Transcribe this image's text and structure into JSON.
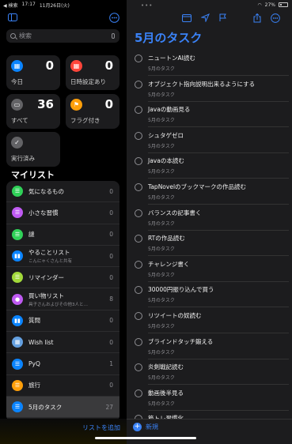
{
  "status": {
    "back": "◀ 検索",
    "time": "17:17",
    "date": "11月26日(火)",
    "battery": "27%"
  },
  "sidebar": {
    "search_placeholder": "検索",
    "smart_lists": [
      {
        "label": "今日",
        "count": "0",
        "color": "#0a84ff",
        "icon": "calendar-icon",
        "glyph": "▦"
      },
      {
        "label": "日時設定あり",
        "count": "0",
        "color": "#ff453a",
        "icon": "calendar-icon",
        "glyph": "▦"
      },
      {
        "label": "すべて",
        "count": "36",
        "color": "#636366",
        "icon": "tray-icon",
        "glyph": "▭"
      },
      {
        "label": "フラグ付き",
        "count": "0",
        "color": "#ff9f0a",
        "icon": "flag-icon",
        "glyph": "⚑"
      },
      {
        "label": "実行済み",
        "count": "",
        "color": "#636366",
        "icon": "checkmark-icon",
        "glyph": "✓"
      }
    ],
    "my_lists_title": "マイリスト",
    "my_lists": [
      {
        "name": "気になるもの",
        "sub": "",
        "count": "0",
        "color": "#30d158",
        "glyph": "☰"
      },
      {
        "name": "小さな習慣",
        "sub": "",
        "count": "0",
        "color": "#bf5af2",
        "glyph": "☰"
      },
      {
        "name": "謎",
        "sub": "",
        "count": "0",
        "color": "#30d158",
        "glyph": "☰"
      },
      {
        "name": "やることリスト",
        "sub": "こんにゃくさんと共有",
        "count": "0",
        "color": "#0a84ff",
        "glyph": "▮▮"
      },
      {
        "name": "リマインダー",
        "sub": "",
        "count": "0",
        "color": "#a2d93a",
        "glyph": "☰"
      },
      {
        "name": "買い物リスト",
        "sub": "具子さんおよびその他3人と…",
        "count": "8",
        "color": "#bf5af2",
        "glyph": "●"
      },
      {
        "name": "質問",
        "sub": "",
        "count": "0",
        "color": "#0a84ff",
        "glyph": "▮▮"
      },
      {
        "name": "Wish list",
        "sub": "",
        "count": "0",
        "color": "#64a0e0",
        "glyph": "▦"
      },
      {
        "name": "PyQ",
        "sub": "",
        "count": "1",
        "color": "#0a84ff",
        "glyph": "☰"
      },
      {
        "name": "旅行",
        "sub": "",
        "count": "0",
        "color": "#ff9f0a",
        "glyph": "☰"
      },
      {
        "name": "5月のタスク",
        "sub": "",
        "count": "27",
        "color": "#0a84ff",
        "glyph": "☰"
      }
    ],
    "add_list": "リストを追加"
  },
  "main": {
    "title": "5月のタスク",
    "tasks": [
      {
        "title": "ニュートンAI読む",
        "list": "5月のタスク"
      },
      {
        "title": "オブジェクト指向説明出来るようにする",
        "list": "5月のタスク"
      },
      {
        "title": "Javaの動画見る",
        "list": "5月のタスク"
      },
      {
        "title": "シュタゲゼロ",
        "list": "5月のタスク"
      },
      {
        "title": "Javaの本読む",
        "list": "5月のタスク"
      },
      {
        "title": "TapNovelのブックマークの作品読む",
        "list": "5月のタスク"
      },
      {
        "title": "バランスの記事書く",
        "list": "5月のタスク"
      },
      {
        "title": "RTの作品読む",
        "list": "5月のタスク"
      },
      {
        "title": "チャレンジ書く",
        "list": "5月のタスク"
      },
      {
        "title": "30000円振り込んで買う",
        "list": "5月のタスク"
      },
      {
        "title": "リツイートの奴読む",
        "list": "5月のタスク"
      },
      {
        "title": "ブラインドタッチ鍛える",
        "list": "5月のタスク"
      },
      {
        "title": "炎剣戦記読む",
        "list": "5月のタスク"
      },
      {
        "title": "動画後半見る",
        "list": "5月のタスク"
      },
      {
        "title": "筋トレ習慣化",
        "list": ""
      }
    ],
    "new_label": "新規"
  }
}
